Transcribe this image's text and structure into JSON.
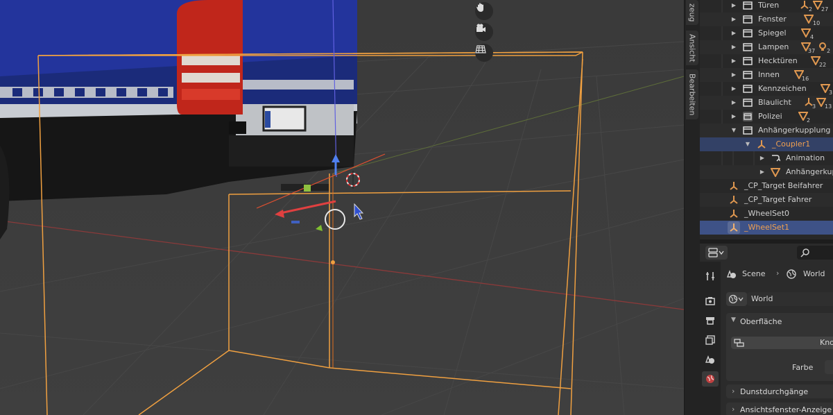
{
  "viewport": {
    "nav_icons": [
      "hand-icon",
      "camera-icon",
      "grid-icon"
    ]
  },
  "n_panel_tabs": [
    "zeug",
    "Ansicht",
    "Bearbeiten"
  ],
  "outliner": {
    "rows": [
      {
        "label": "Türen",
        "badge1": "2",
        "badge2": "27"
      },
      {
        "label": "Fenster",
        "badge1": "10"
      },
      {
        "label": "Spiegel",
        "badge1": "4"
      },
      {
        "label": "Lampen",
        "badge1": "37",
        "badge2": "2"
      },
      {
        "label": "Hecktüren",
        "badge1": "22"
      },
      {
        "label": "Innen",
        "badge1": "16"
      },
      {
        "label": "Kennzeichen",
        "badge1": "3"
      },
      {
        "label": "Blaulicht",
        "badge1": "3",
        "badge2": "13"
      },
      {
        "label": "Polizei",
        "badge1": "2"
      },
      {
        "label": "Anhängerkupplung"
      },
      {
        "label": "_Coupler1"
      },
      {
        "label": "Animation"
      },
      {
        "label": "Anhängerkup"
      },
      {
        "label": "_CP_Target Beifahrer"
      },
      {
        "label": "_CP_Target Fahrer"
      },
      {
        "label": "_WheelSet0"
      },
      {
        "label": "_WheelSet1"
      }
    ]
  },
  "properties": {
    "breadcrumb": {
      "scene": "Scene",
      "world": "World"
    },
    "world_name": "World",
    "sections": {
      "surface": "Oberfläche",
      "nodes_button": "Knot",
      "color_label": "Farbe",
      "mist": "Dunstdurchgänge",
      "viewport_display": "Ansichtsfenster-Anzeige"
    }
  },
  "colors": {
    "selection_orange": "#f0a050",
    "active_row": "#3e5287",
    "selected_row": "#334166",
    "x_axis": "#c04040",
    "y_axis": "#7aa830",
    "z_axis": "#4a7ae0"
  }
}
